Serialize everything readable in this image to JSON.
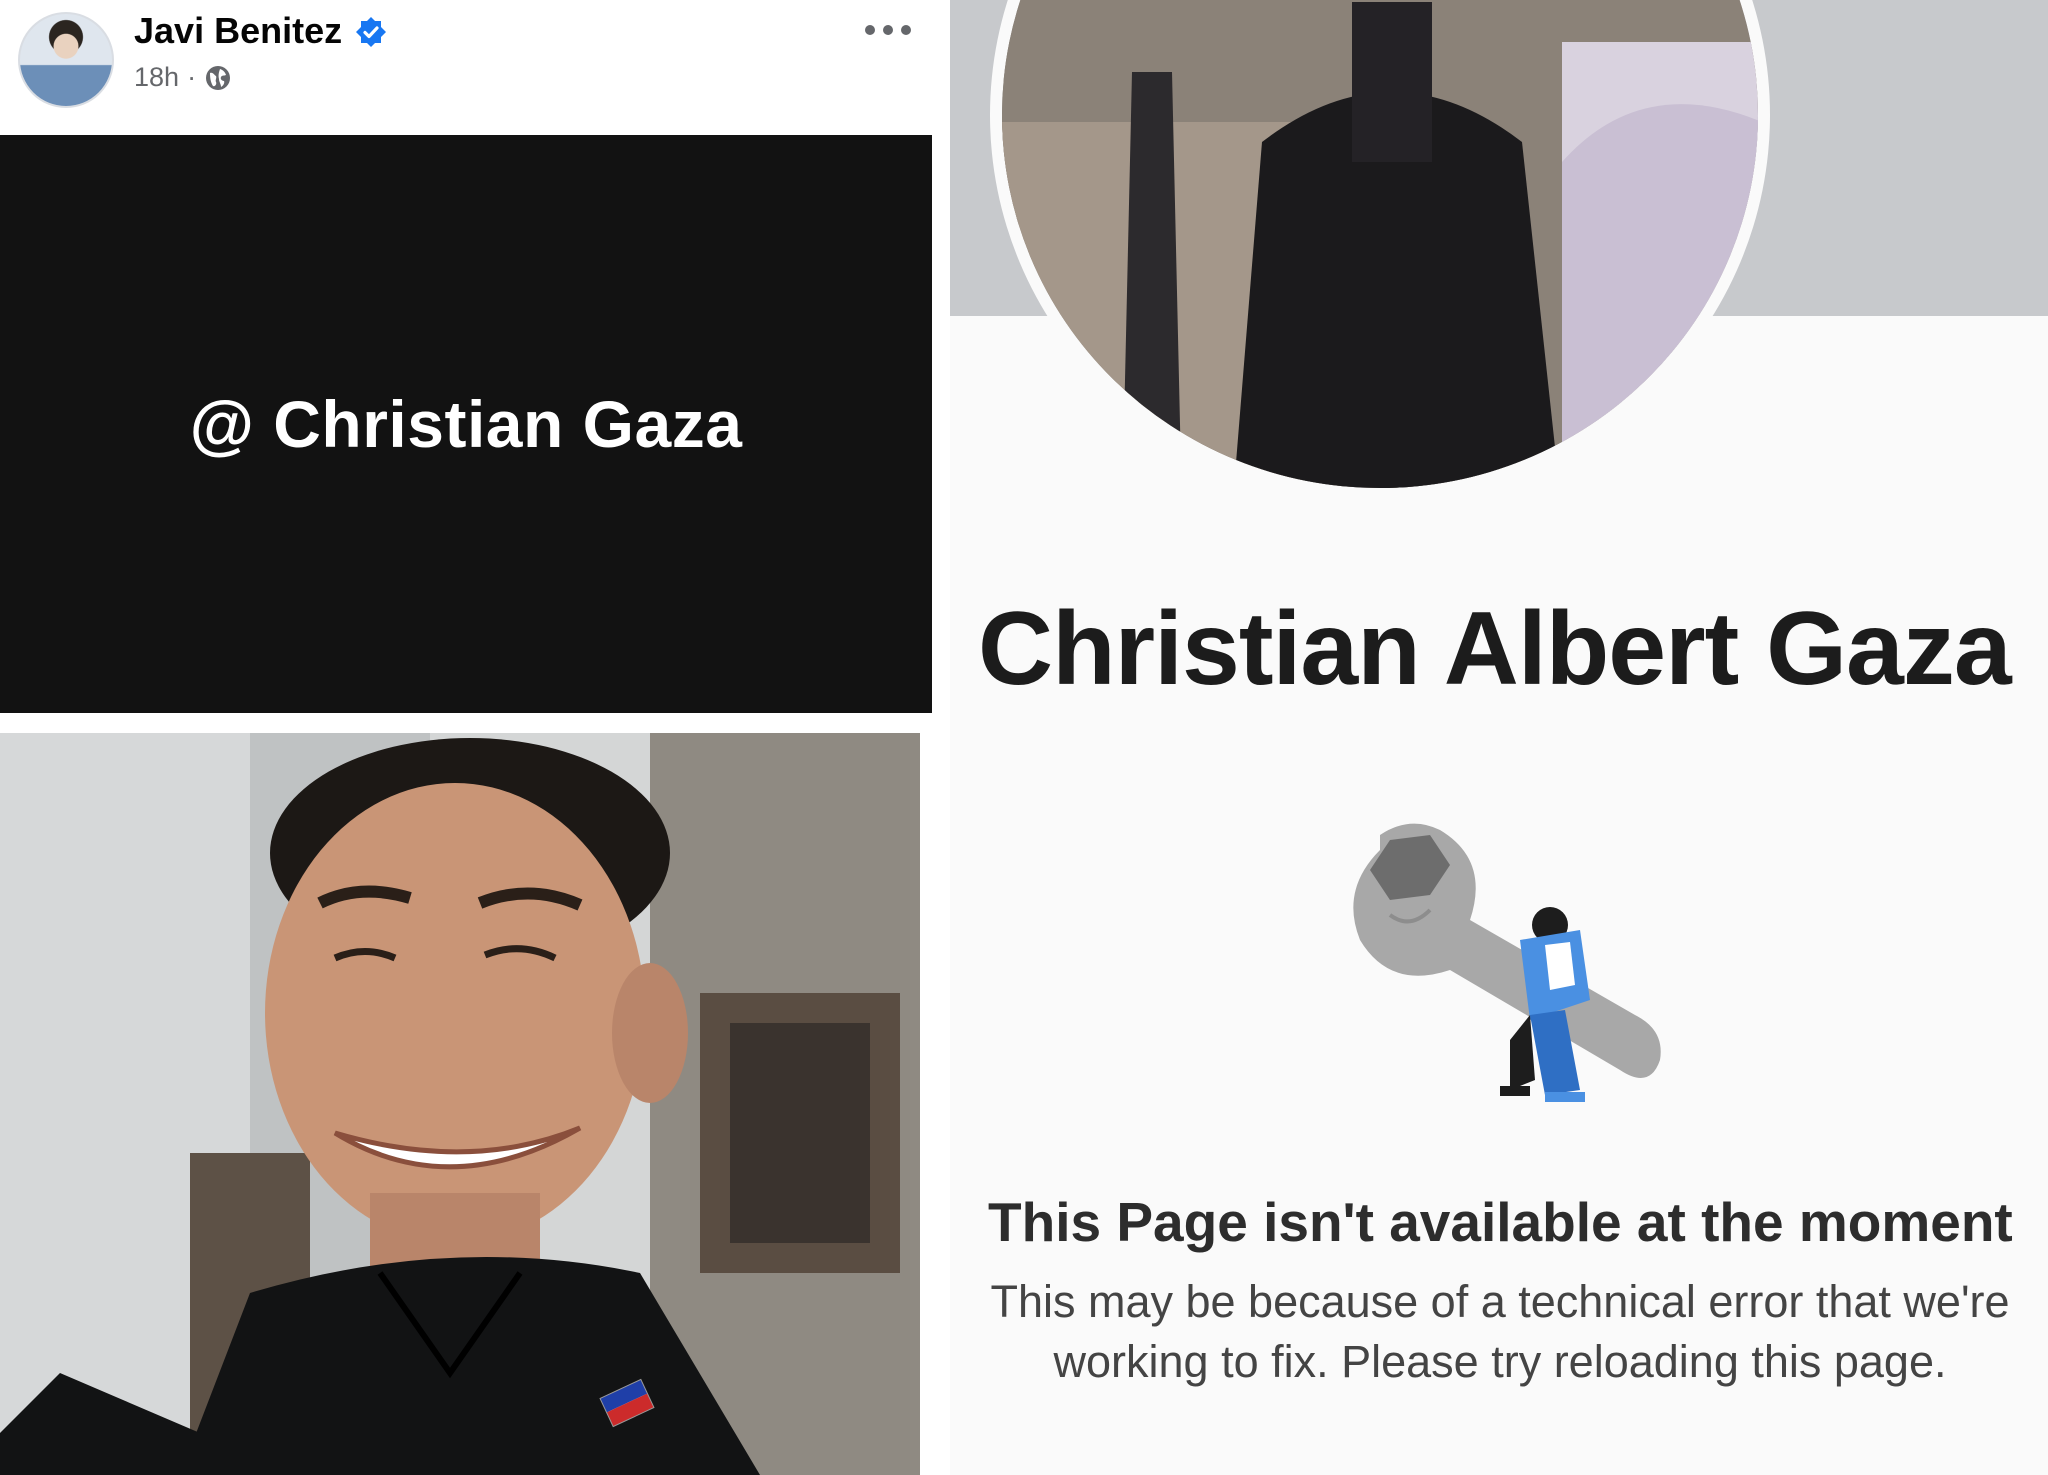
{
  "post": {
    "author_name": "Javi Benitez",
    "timestamp": "18h",
    "separator": "·",
    "privacy_icon": "globe-icon",
    "verified_icon": "verified-badge-icon",
    "more_icon": "more-options-icon",
    "mention_text": "@ Christian Gaza"
  },
  "profile": {
    "name": "Christian Albert Gaza",
    "error_title": "This Page isn't available at the moment",
    "error_body": "This may be because of a technical error that we're working to fix. Please try reloading this page.",
    "illustration_icon": "wrench-icon"
  },
  "colors": {
    "verified_blue": "#1877f2",
    "card_black": "#121212",
    "illustration_blue": "#4a90e2",
    "wrench_gray": "#a8a8a8"
  }
}
